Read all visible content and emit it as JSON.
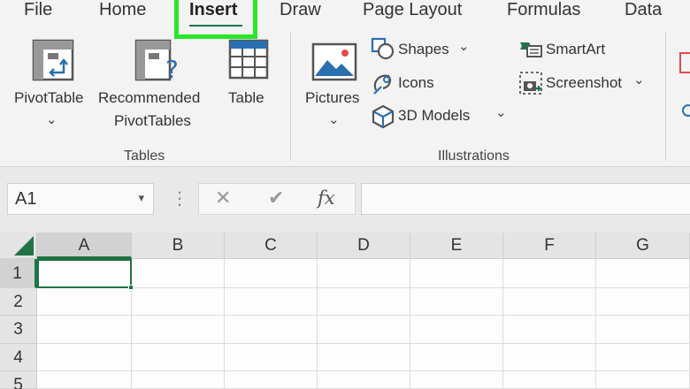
{
  "menu": {
    "tabs": [
      {
        "label": "File"
      },
      {
        "label": "Home"
      },
      {
        "label": "Insert"
      },
      {
        "label": "Draw"
      },
      {
        "label": "Page Layout"
      },
      {
        "label": "Formulas"
      },
      {
        "label": "Data"
      }
    ],
    "active": "Insert"
  },
  "ribbon": {
    "tables": {
      "group_label": "Tables",
      "pivot_line1": "PivotTable",
      "rec_line1": "Recommended",
      "rec_line2": "PivotTables",
      "table": "Table"
    },
    "illustrations": {
      "group_label": "Illustrations",
      "pictures": "Pictures",
      "shapes": "Shapes",
      "icons": "Icons",
      "models": "3D Models",
      "smartart": "SmartArt",
      "screenshot": "Screenshot"
    }
  },
  "formula_bar": {
    "name_box": "A1",
    "fx": "fx",
    "value": ""
  },
  "grid": {
    "columns": [
      "A",
      "B",
      "C",
      "D",
      "E",
      "F",
      "G"
    ],
    "rows": [
      "1",
      "2",
      "3",
      "4",
      "5"
    ],
    "selected_cell": "A1"
  },
  "colors": {
    "accent": "#217346",
    "highlight": "#29e629"
  }
}
